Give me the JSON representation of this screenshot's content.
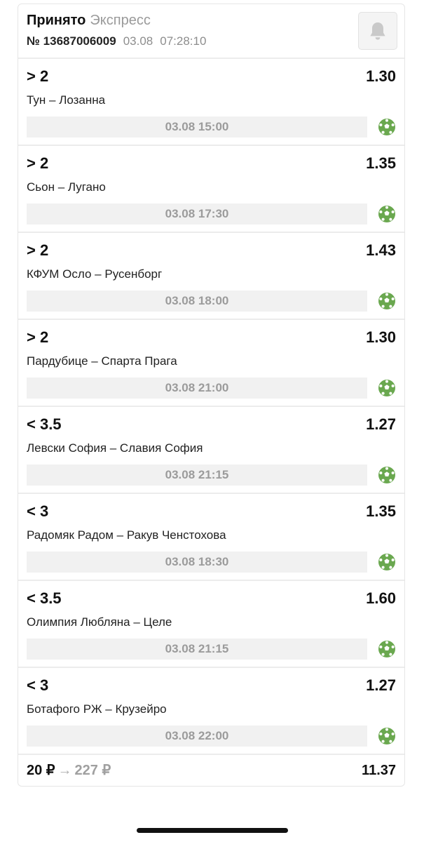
{
  "header": {
    "status": "Принято",
    "bet_type": "Экспресс",
    "bet_number": "№ 13687006009",
    "date": "03.08",
    "time": "07:28:10",
    "bell_icon": "bell-icon"
  },
  "events": [
    {
      "outcome": "> 2",
      "odds": "1.30",
      "teams": "Тун – Лозанна",
      "start": "03.08 15:00",
      "sport_icon": "soccer-ball-icon"
    },
    {
      "outcome": "> 2",
      "odds": "1.35",
      "teams": "Сьон – Лугано",
      "start": "03.08 17:30",
      "sport_icon": "soccer-ball-icon"
    },
    {
      "outcome": "> 2",
      "odds": "1.43",
      "teams": "КФУМ Осло – Русенборг",
      "start": "03.08 18:00",
      "sport_icon": "soccer-ball-icon"
    },
    {
      "outcome": "> 2",
      "odds": "1.30",
      "teams": "Пардубице – Спарта Прага",
      "start": "03.08 21:00",
      "sport_icon": "soccer-ball-icon"
    },
    {
      "outcome": "< 3.5",
      "odds": "1.27",
      "teams": "Левски София – Славия София",
      "start": "03.08 21:15",
      "sport_icon": "soccer-ball-icon"
    },
    {
      "outcome": "< 3",
      "odds": "1.35",
      "teams": "Радомяк Радом – Ракув Ченстохова",
      "start": "03.08 18:30",
      "sport_icon": "soccer-ball-icon"
    },
    {
      "outcome": "< 3.5",
      "odds": "1.60",
      "teams": "Олимпия Любляна – Целе",
      "start": "03.08 21:15",
      "sport_icon": "soccer-ball-icon"
    },
    {
      "outcome": "< 3",
      "odds": "1.27",
      "teams": "Ботафого РЖ – Крузейро",
      "start": "03.08 22:00",
      "sport_icon": "soccer-ball-icon"
    }
  ],
  "footer": {
    "stake": "20 ₽",
    "arrow": "→",
    "payout": "227 ₽",
    "total_odds": "11.37"
  },
  "colors": {
    "accent_green": "#6aa84f",
    "muted_text": "#9b9b9b",
    "time_bar_bg": "#f1f1f1"
  }
}
